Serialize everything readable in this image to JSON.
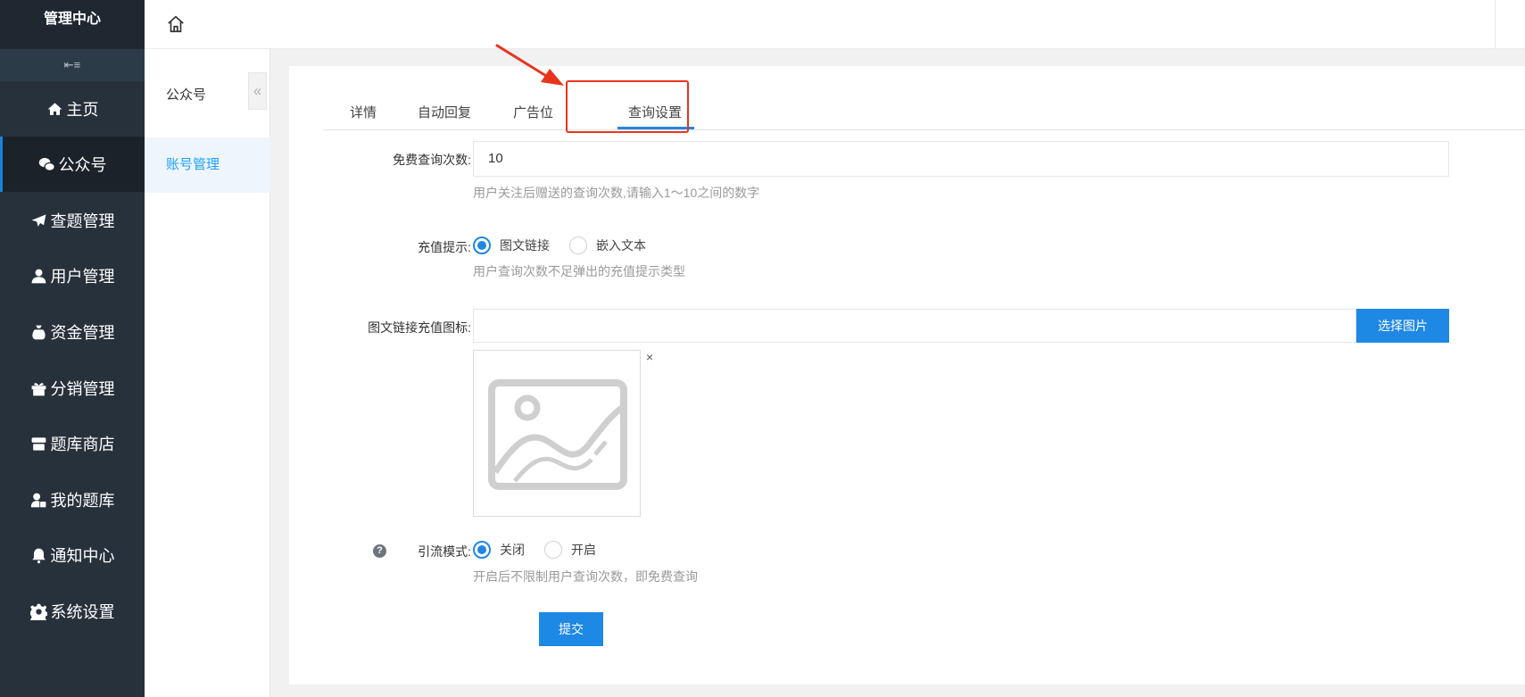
{
  "brand": "管理中心",
  "sidebar": {
    "collapse_icon": "indent-icon",
    "items": [
      {
        "label": "主页",
        "icon": "home-icon"
      },
      {
        "label": "公众号",
        "icon": "wechat-icon",
        "active": true
      },
      {
        "label": "查题管理",
        "icon": "paper-plane-icon"
      },
      {
        "label": "用户管理",
        "icon": "user-icon"
      },
      {
        "label": "资金管理",
        "icon": "money-bag-icon"
      },
      {
        "label": "分销管理",
        "icon": "gift-icon"
      },
      {
        "label": "题库商店",
        "icon": "store-icon"
      },
      {
        "label": "我的题库",
        "icon": "user-book-icon"
      },
      {
        "label": "通知中心",
        "icon": "bell-icon"
      },
      {
        "label": "系统设置",
        "icon": "gear-icon"
      }
    ]
  },
  "submenu": {
    "title": "公众号",
    "items": [
      {
        "label": "账号管理",
        "active": true
      }
    ],
    "toggle": "«"
  },
  "topbar": {
    "home_icon": "home-outline-icon"
  },
  "tabs": [
    {
      "label": "详情"
    },
    {
      "label": "自动回复"
    },
    {
      "label": "广告位"
    },
    {
      "label": "查询设置",
      "active": true
    }
  ],
  "form": {
    "free_queries": {
      "label": "免费查询次数:",
      "value": "10",
      "hint": "用户关注后赠送的查询次数,请输入1～10之间的数字"
    },
    "recharge_prompt": {
      "label": "充值提示:",
      "options": [
        {
          "label": "图文链接",
          "checked": true
        },
        {
          "label": "嵌入文本",
          "checked": false
        }
      ],
      "hint": "用户查询次数不足弹出的充值提示类型"
    },
    "recharge_icon": {
      "label": "图文链接充值图标:",
      "value": "",
      "button": "选择图片",
      "remove": "×",
      "preview_icon": "image-placeholder-icon"
    },
    "traffic_mode": {
      "label": "引流模式:",
      "help": "?",
      "options": [
        {
          "label": "关闭",
          "checked": true
        },
        {
          "label": "开启",
          "checked": false
        }
      ],
      "hint": "开启后不限制用户查询次数，即免费查询"
    },
    "submit": "提交"
  },
  "colors": {
    "sidebar_bg": "#27313c",
    "accent": "#1e88e5",
    "annotation": "#e8331d"
  }
}
